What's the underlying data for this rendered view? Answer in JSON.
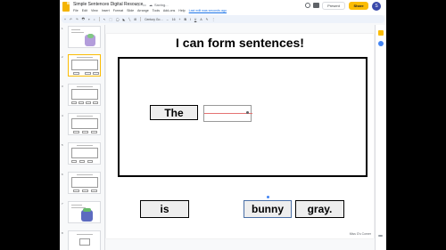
{
  "app": {
    "doc_title": "Simple Sentences Digital Resource",
    "saving_status": "Saving...",
    "menu": [
      "File",
      "Edit",
      "View",
      "Insert",
      "Format",
      "Slide",
      "Arrange",
      "Tools",
      "Add-ons",
      "Help"
    ],
    "last_edit": "Last edit was seconds ago",
    "present_label": "Present",
    "share_label": "Share",
    "avatar_initial": "S",
    "toolbar": [
      "+",
      "↶",
      "↷",
      "🖶",
      "⌖",
      "⌕",
      "↖",
      "⬚",
      "◯",
      "◣",
      "╲",
      "⊞",
      "Century Go…",
      "–",
      "16",
      "+",
      "B",
      "I",
      "U",
      "A",
      "✎",
      "⋮"
    ]
  },
  "filmstrip": {
    "numbers": [
      "1",
      "2",
      "3",
      "4",
      "5",
      "6",
      "7",
      "8"
    ]
  },
  "slide": {
    "title": "I can form sentences!",
    "words": {
      "the": "The",
      "is": "is",
      "bunny": "bunny",
      "gray": "gray."
    },
    "credit": "Miss G's Corner"
  },
  "colors": {
    "accent": "#fbbc04",
    "selection": "#4285f4"
  }
}
